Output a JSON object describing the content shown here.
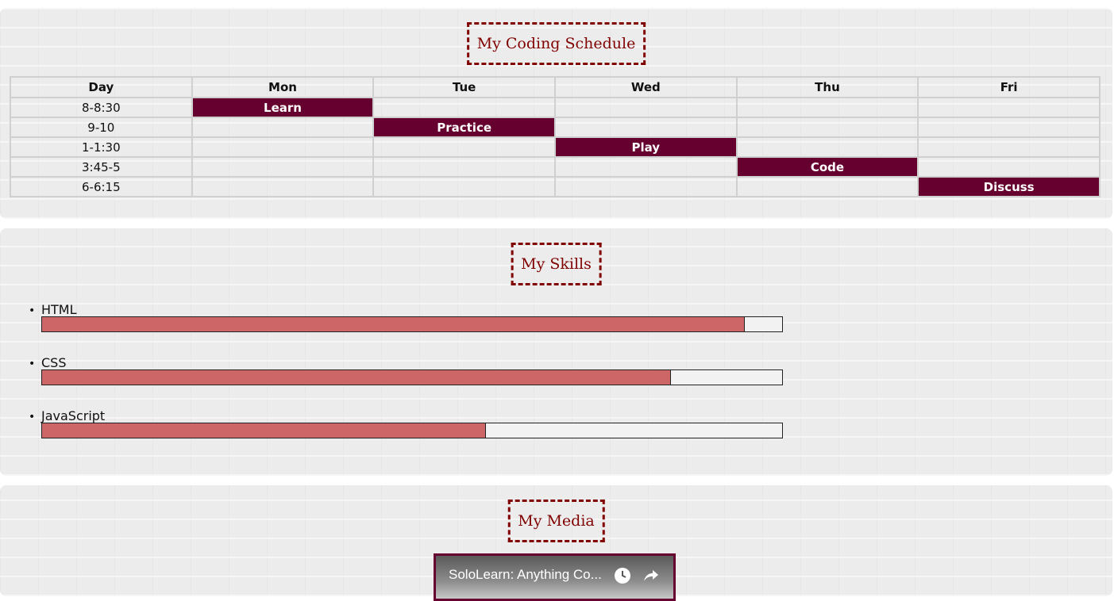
{
  "schedule": {
    "title": "My Coding Schedule",
    "headers": [
      "Day",
      "Mon",
      "Tue",
      "Wed",
      "Thu",
      "Fri"
    ],
    "rows": [
      {
        "time": "8-8:30",
        "cells": [
          "Learn",
          "",
          "",
          "",
          ""
        ]
      },
      {
        "time": "9-10",
        "cells": [
          "",
          "Practice",
          "",
          "",
          ""
        ]
      },
      {
        "time": "1-1:30",
        "cells": [
          "",
          "",
          "Play",
          "",
          ""
        ]
      },
      {
        "time": "3:45-5",
        "cells": [
          "",
          "",
          "",
          "Code",
          ""
        ]
      },
      {
        "time": "6-6:15",
        "cells": [
          "",
          "",
          "",
          "",
          "Discuss"
        ]
      }
    ],
    "active_color": "#66002e"
  },
  "skills": {
    "title": "My Skills",
    "items": [
      {
        "label": "HTML",
        "percent": 95
      },
      {
        "label": "CSS",
        "percent": 85
      },
      {
        "label": "JavaScript",
        "percent": 60
      }
    ],
    "fill_color": "#cd6666"
  },
  "media": {
    "title": "My Media",
    "video_title": "SoloLearn: Anything Co...",
    "icons": [
      "clock-icon",
      "share-icon"
    ]
  },
  "accent_color": "#800000"
}
